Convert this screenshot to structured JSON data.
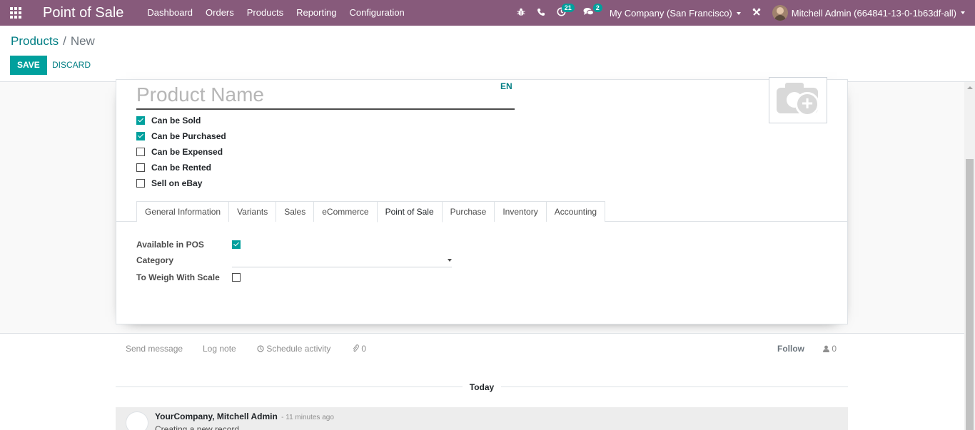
{
  "navbar": {
    "brand": "Point of Sale",
    "menu": [
      "Dashboard",
      "Orders",
      "Products",
      "Reporting",
      "Configuration"
    ],
    "activity_count": "21",
    "message_count": "2",
    "company": "My Company (San Francisco)",
    "user": "Mitchell Admin (664841-13-0-1b63df-all)",
    "icons": [
      "apps-icon",
      "bug-icon",
      "phone-icon",
      "clock-icon",
      "chat-icon",
      "tools-icon"
    ],
    "color": "#875a7b"
  },
  "control": {
    "breadcrumb_parent": "Products",
    "breadcrumb_separator": "/",
    "breadcrumb_current": "New",
    "save_label": "SAVE",
    "discard_label": "DISCARD"
  },
  "form": {
    "name_placeholder": "Product Name",
    "name_value": "",
    "lang": "EN",
    "checkboxes": [
      {
        "label": "Can be Sold",
        "checked": true
      },
      {
        "label": "Can be Purchased",
        "checked": true
      },
      {
        "label": "Can be Expensed",
        "checked": false
      },
      {
        "label": "Can be Rented",
        "checked": false
      },
      {
        "label": "Sell on eBay",
        "checked": false
      }
    ],
    "tabs": [
      "General Information",
      "Variants",
      "Sales",
      "eCommerce",
      "Point of Sale",
      "Purchase",
      "Inventory",
      "Accounting"
    ],
    "active_tab": "Point of Sale",
    "pos": {
      "available_label": "Available in POS",
      "available_checked": true,
      "category_label": "Category",
      "category_value": "",
      "weigh_label": "To Weigh With Scale",
      "weigh_checked": false
    }
  },
  "chatter": {
    "send_message": "Send message",
    "log_note": "Log note",
    "schedule_activity": "Schedule activity",
    "attachments": "0",
    "follow": "Follow",
    "followers": "0",
    "today": "Today",
    "message": {
      "author": "YourCompany, Mitchell Admin",
      "time": "- 11 minutes ago",
      "body": "Creating a new record..."
    }
  },
  "colors": {
    "accent": "#00a09d",
    "link": "#017e84"
  }
}
